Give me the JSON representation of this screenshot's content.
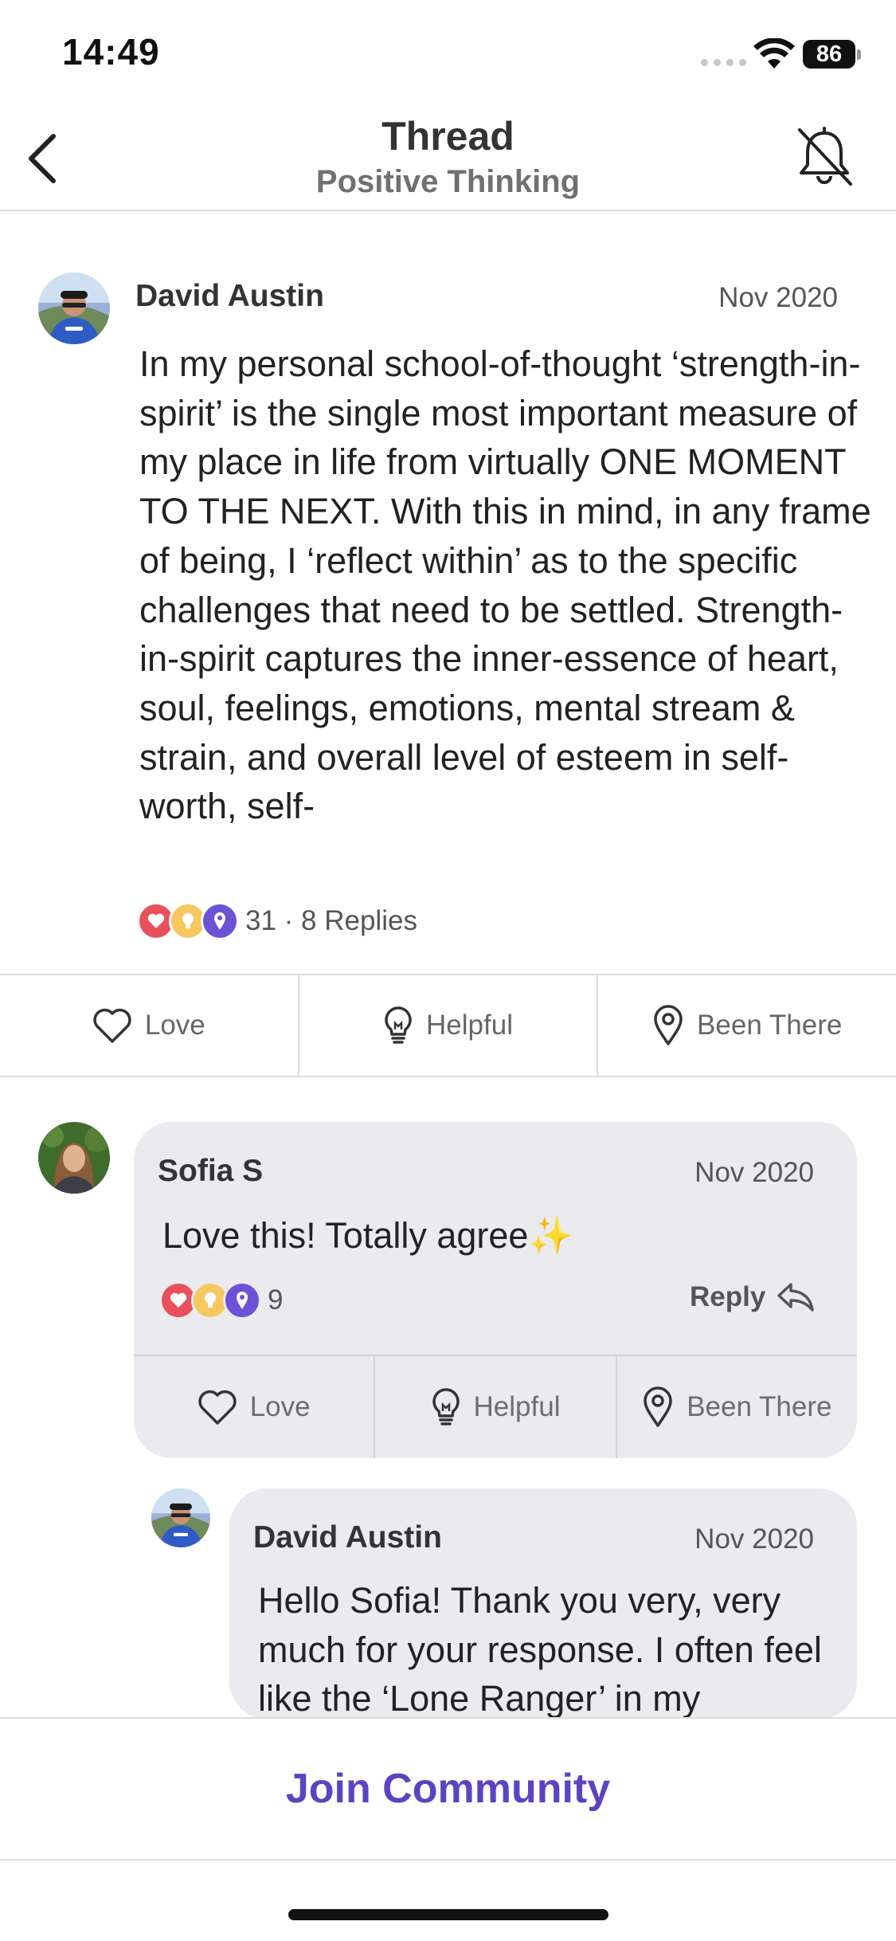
{
  "status_bar": {
    "time": "14:49",
    "battery": "86"
  },
  "nav": {
    "title": "Thread",
    "subtitle": "Positive Thinking"
  },
  "post": {
    "author": "David Austin",
    "date": "Nov 2020",
    "body": "In my personal school-of-thought ‘strength-in-spirit’ is the single most important measure of my place in life from virtually ONE MOMENT TO THE NEXT. With this in mind, in any frame of being, I ‘reflect within’ as to the specific challenges that need to be settled. Strength-in-spirit captures the inner-essence of heart, soul, feelings, emotions, mental stream & strain, and overall level of esteem in self-worth, self-",
    "reaction_summary": "31 · 8 Replies"
  },
  "actions": {
    "love": "Love",
    "helpful": "Helpful",
    "been_there": "Been There"
  },
  "comment": {
    "author": "Sofia S",
    "date": "Nov 2020",
    "body": "Love this! Totally agree✨",
    "reaction_count": "9",
    "reply_label": "Reply"
  },
  "reply": {
    "author": "David Austin",
    "date": "Nov 2020",
    "body": "Hello Sofia! Thank you very, very much for your response. I often feel like the ‘Lone Ranger’ in my"
  },
  "join_label": "Join Community",
  "icons": {
    "back": "chevron-left-icon",
    "bell": "bell-off-icon",
    "love": "heart-icon",
    "helpful": "lightbulb-icon",
    "been_there": "map-pin-icon",
    "reply": "reply-arrow-icon"
  },
  "colors": {
    "accent": "#5c43c2",
    "love": "#e8505b",
    "helpful": "#f6c85f",
    "been_there": "#6b52d6"
  }
}
